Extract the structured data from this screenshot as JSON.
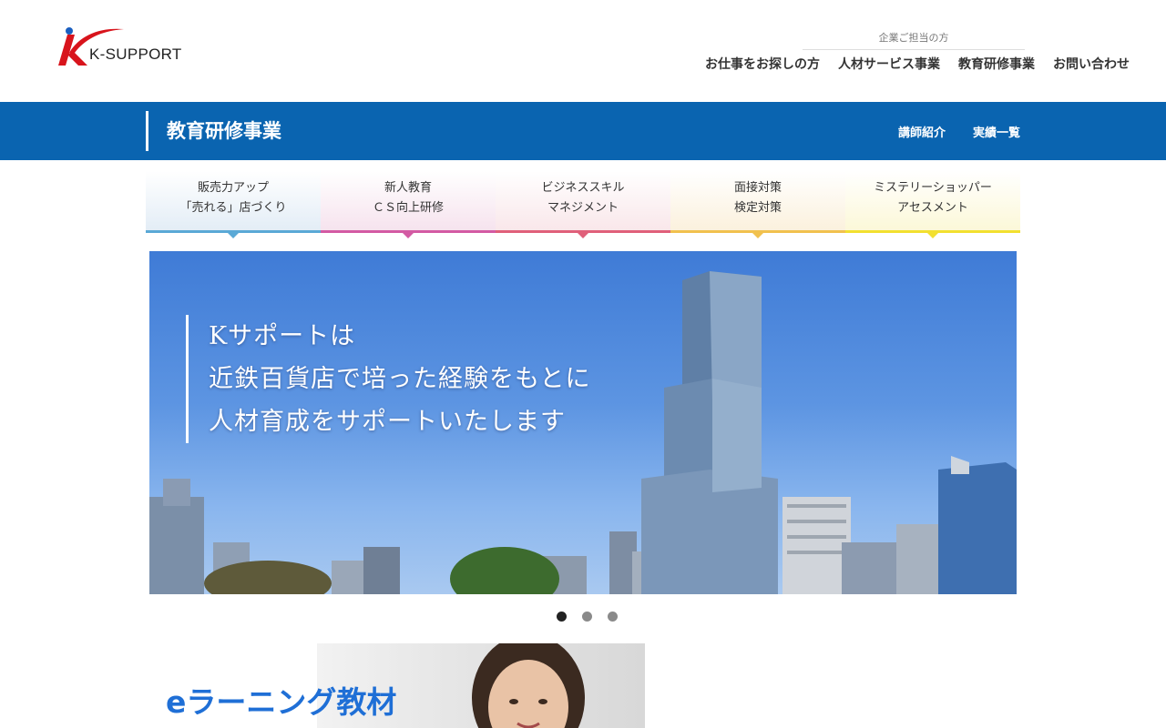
{
  "header": {
    "logo_text": "K-SUPPORT",
    "corp_label": "企業ご担当の方",
    "nav": [
      {
        "label": "お仕事をお探しの方"
      },
      {
        "label": "人材サービス事業"
      },
      {
        "label": "教育研修事業"
      },
      {
        "label": "お問い合わせ"
      }
    ]
  },
  "section": {
    "title": "教育研修事業",
    "sub_nav": [
      {
        "label": "講師紹介"
      },
      {
        "label": "実績一覧"
      }
    ],
    "color": "#0a64b0"
  },
  "tabs": [
    {
      "line1": "販売力アップ",
      "line2": "「売れる」店づくり",
      "color": "#5aa9d6"
    },
    {
      "line1": "新人教育",
      "line2": "ＣＳ向上研修",
      "color": "#d35aa3"
    },
    {
      "line1": "ビジネススキル",
      "line2": "マネジメント",
      "color": "#e0607a"
    },
    {
      "line1": "面接対策",
      "line2": "検定対策",
      "color": "#f1c14e"
    },
    {
      "line1": "ミステリーショッパー",
      "line2": "アセスメント",
      "color": "#f2e030"
    }
  ],
  "hero": {
    "lines": [
      "Kサポートは",
      "近鉄百貨店で培った経験をもとに",
      "人材育成をサポートいたします"
    ],
    "slide_count": 3,
    "active_slide": 1
  },
  "elearning": {
    "title": "eラーニング教材"
  }
}
